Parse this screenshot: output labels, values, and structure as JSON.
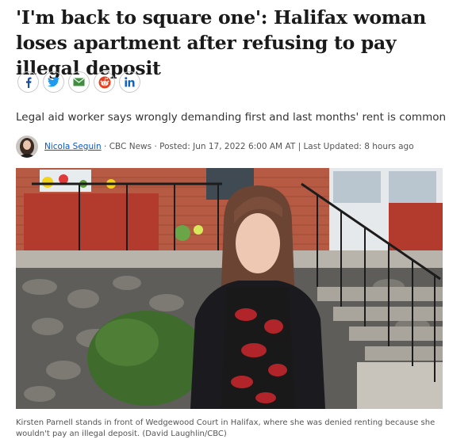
{
  "article": {
    "headline": "'I'm back to square one': Halifax woman loses apartment after refusing to pay illegal deposit",
    "subheadline": "Legal aid worker says wrongly demanding first and last months' rent is common",
    "author": "Nicola Seguin",
    "source": "CBC News",
    "posted_label": "Posted:",
    "posted_date": "Jun 17, 2022 6:00 AM AT",
    "last_updated_label": "Last Updated:",
    "last_updated": "8 hours ago",
    "photo_caption": "Kirsten Parnell stands in front of Wedgewood Court in Halifax, where she was denied renting because she wouldn't pay an illegal deposit. (David Laughlin/CBC)"
  },
  "share_buttons": [
    {
      "icon": "facebook-icon",
      "color": "#1b4e9b"
    },
    {
      "icon": "twitter-icon",
      "color": "#1d9bf0"
    },
    {
      "icon": "email-icon",
      "color": "#3f8f3f"
    },
    {
      "icon": "reddit-icon",
      "color": "#e8401c"
    },
    {
      "icon": "linkedin-icon",
      "color": "#0a66c2"
    }
  ]
}
